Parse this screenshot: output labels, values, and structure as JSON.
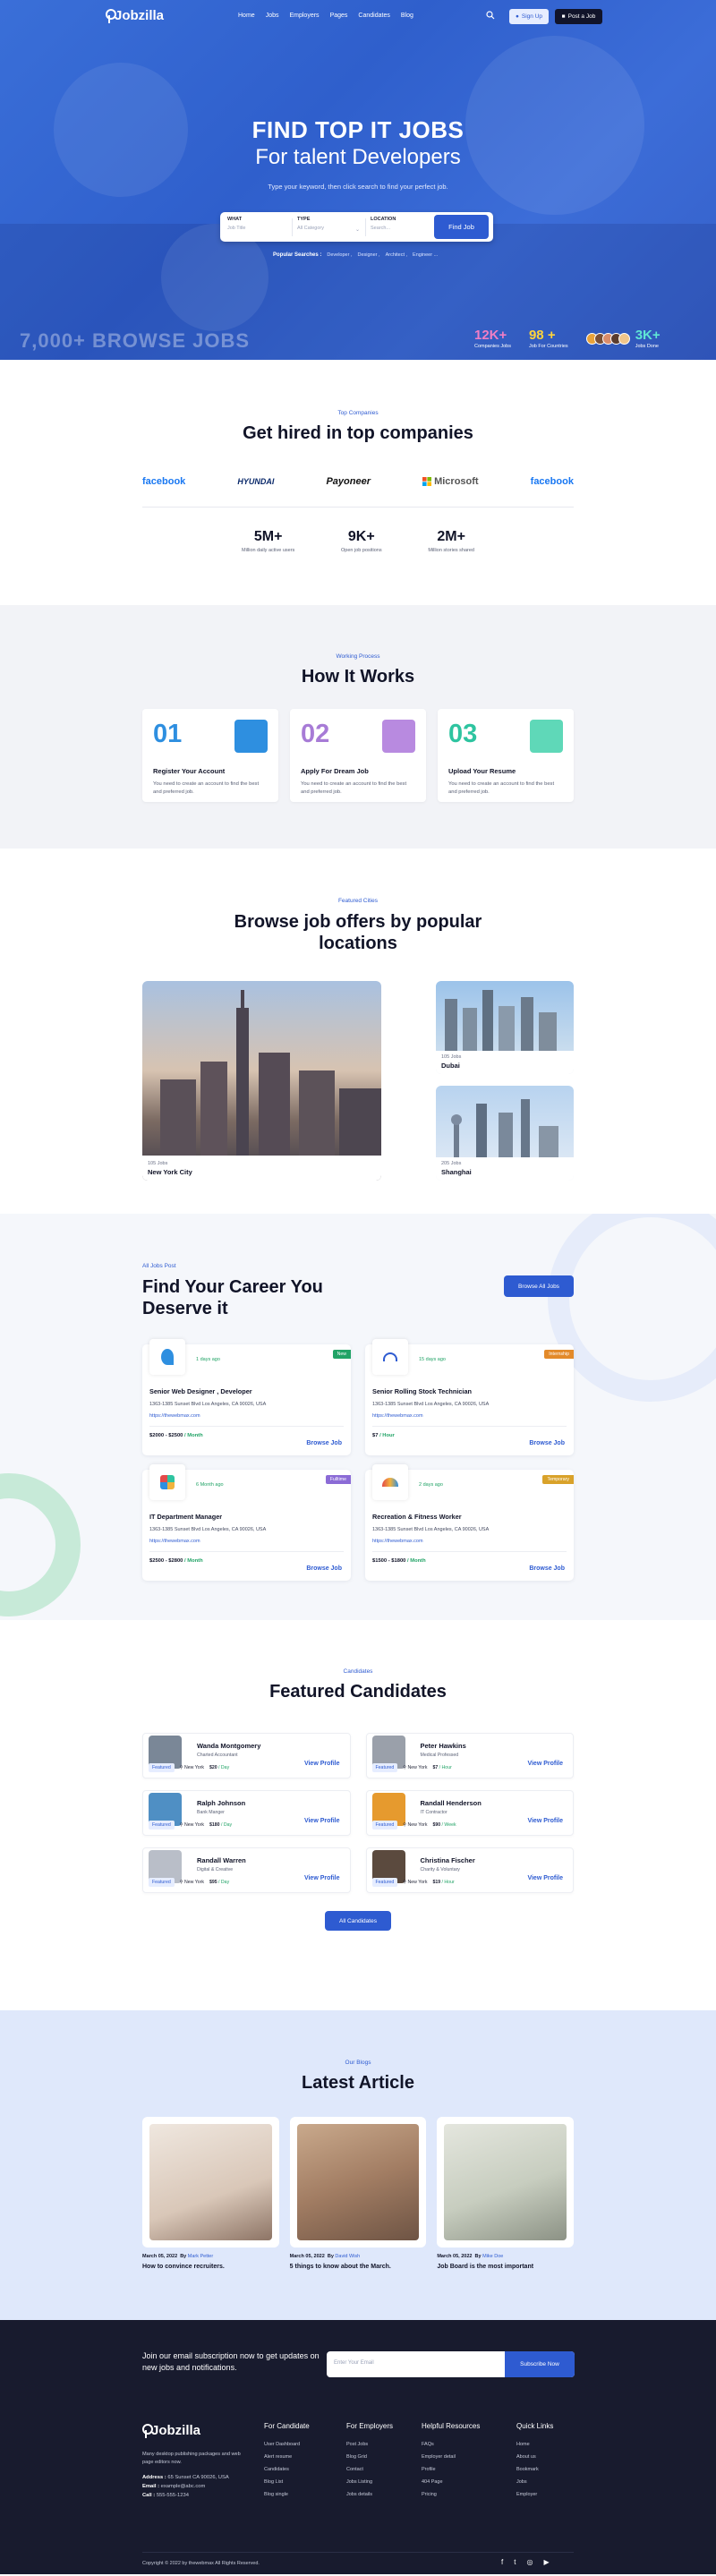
{
  "brand": {
    "name": "Jobzilla"
  },
  "nav": {
    "items": [
      "Home",
      "Jobs",
      "Employers",
      "Pages",
      "Candidates",
      "Blog"
    ],
    "sign_up": "Sign Up",
    "post_job": "Post a Job"
  },
  "hero": {
    "title": "FIND TOP IT JOBS",
    "subtitle": "For talent Developers",
    "description": "Type your keyword, then click search to find your perfect job.",
    "search": {
      "what_label": "WHAT",
      "what_placeholder": "Job Title",
      "type_label": "TYPE",
      "type_value": "All Category",
      "location_label": "LOCATION",
      "location_placeholder": "Search...",
      "button": "Find Job"
    },
    "popular_label": "Popular Searches :",
    "popular": [
      "Developer ,",
      "Designer ,",
      "Architect ,",
      "Engineer ..."
    ],
    "browse_text": "7,000+ BROWSE JOBS",
    "stats": [
      {
        "value": "12K+",
        "label": "Companies Jobs",
        "color": "#f07ec5"
      },
      {
        "value": "98 +",
        "label": "Job For Countries",
        "color": "#ffd43b"
      },
      {
        "value": "3K+",
        "label": "Jobs Done",
        "color": "#5fe5d5"
      }
    ]
  },
  "companies": {
    "tag": "Top Companies",
    "title": "Get hired in top companies",
    "logos": [
      "facebook",
      "HYUNDAI",
      "Payoneer",
      "Microsoft",
      "facebook"
    ],
    "numbers": [
      {
        "value": "5M+",
        "label": "Million daily active users"
      },
      {
        "value": "9K+",
        "label": "Open job positions"
      },
      {
        "value": "2M+",
        "label": "Million stories shared"
      }
    ]
  },
  "how": {
    "tag": "Working Process",
    "title": "How It Works",
    "steps": [
      {
        "num": "01",
        "title": "Register Your Account",
        "desc": "You need to create an account to find the best and preferred job.",
        "color": "#2e8fe0",
        "icon_bg": "#2e8fe0"
      },
      {
        "num": "02",
        "title": "Apply For Dream Job",
        "desc": "You need to create an account to find the best and preferred job.",
        "color": "#a77bd6",
        "icon_bg": "#b88ae0"
      },
      {
        "num": "03",
        "title": "Upload Your Resume",
        "desc": "You need to create an account to find the best and preferred job.",
        "color": "#2ec4a0",
        "icon_bg": "#5fd8b8"
      }
    ]
  },
  "cities": {
    "tag": "Featured Cities",
    "title": "Browse job offers by popular locations",
    "items": [
      {
        "jobs": "105 Jobs",
        "name": "New York City"
      },
      {
        "jobs": "105 Jobs",
        "name": "Dubai"
      },
      {
        "jobs": "205 Jobs",
        "name": "Shanghai"
      }
    ]
  },
  "jobs": {
    "tag": "All Jobs Post",
    "title": "Find Your Career You Deserve it",
    "browse_button": "Browse All Jobs",
    "items": [
      {
        "ago": "1 days ago",
        "badge": "New",
        "badge_color": "#21a366",
        "title": "Senior Web Designer , Developer",
        "address": "1363-1385 Sunset Blvd Los Angeles, CA 90026, USA",
        "url": "https://thewebmax.com",
        "salary": "$2000 - $2500",
        "period": " / Month",
        "browse": "Browse Job",
        "logo_color": "#2e8fe0"
      },
      {
        "ago": "15 days ago",
        "badge": "Internship",
        "badge_color": "#e38a2a",
        "title": "Senior Rolling Stock Technician",
        "address": "1363-1385 Sunset Blvd Los Angeles, CA 90026, USA",
        "url": "https://thewebmax.com",
        "salary": "$7",
        "period": " / Hour",
        "browse": "Browse Job",
        "logo_color": "#2e5bd1"
      },
      {
        "ago": "6 Month ago",
        "badge": "Fulltime",
        "badge_color": "#8b6bd6",
        "title": "IT Department Manager",
        "address": "1363-1385 Sunset Blvd Los Angeles, CA 90026, USA",
        "url": "https://thewebmax.com",
        "salary": "$2500 - $2800",
        "period": " / Month",
        "browse": "Browse Job",
        "logo_color": "#2ec4a0"
      },
      {
        "ago": "2 days ago",
        "badge": "Temporary",
        "badge_color": "#d9a22a",
        "title": "Recreation & Fitness Worker",
        "address": "1363-1385 Sunset Blvd Los Angeles, CA 90026, USA",
        "url": "https://thewebmax.com",
        "salary": "$1500 - $1800",
        "period": " / Month",
        "browse": "Browse Job",
        "logo_color": "#e34a4a"
      }
    ]
  },
  "candidates": {
    "tag": "Candidates",
    "title": "Featured Candidates",
    "featured_label": "Featured",
    "view_label": "View Profile",
    "all_button": "All Candidates",
    "items": [
      {
        "name": "Wanda Montgomery",
        "role": "Charted Accountant",
        "location": "New York",
        "rate": "$20",
        "period": " / Day",
        "photo": "#7a8797"
      },
      {
        "name": "Peter Hawkins",
        "role": "Medical Professed",
        "location": "New York",
        "rate": "$7",
        "period": " / Hour",
        "photo": "#9aa0aa"
      },
      {
        "name": "Ralph Johnson",
        "role": "Bank Manger",
        "location": "New York",
        "rate": "$180",
        "period": " / Day",
        "photo": "#4f8fc4"
      },
      {
        "name": "Randall Henderson",
        "role": "IT Contractor",
        "location": "New York",
        "rate": "$90",
        "period": " / Week",
        "photo": "#e69a2e"
      },
      {
        "name": "Randall Warren",
        "role": "Digital & Creative",
        "location": "New York",
        "rate": "$95",
        "period": " / Day",
        "photo": "#b9bec8"
      },
      {
        "name": "Christina Fischer",
        "role": "Charity & Voluntary",
        "location": "New York",
        "rate": "$19",
        "period": " / Hour",
        "photo": "#5b4a3e"
      }
    ]
  },
  "blog": {
    "tag": "Our Blogs",
    "title": "Latest Article",
    "items": [
      {
        "date": "March 05, 2022",
        "by": "By",
        "author": "Mark Petter",
        "title": "How to convince recruiters.",
        "img": "#d9c7b8"
      },
      {
        "date": "March 05, 2022",
        "by": "By",
        "author": "David Wish",
        "title": "5 things to know about the March.",
        "img": "#a27d63"
      },
      {
        "date": "March 05, 2022",
        "by": "By",
        "author": "Mike Doe",
        "title": "Job Board is the most important",
        "img": "#c7cdbf"
      }
    ]
  },
  "footer": {
    "newsletter": "Join our email subscription now to get updates on new jobs and notifications.",
    "email_placeholder": "Enter Your Email",
    "subscribe": "Subscribe Now",
    "desc": "Many desktop publishing packages and web page editors now.",
    "address_label": "Address :",
    "address": "65 Sunset CA 90026, USA",
    "email_label": "Email :",
    "email": "example@abc.com",
    "call_label": "Call :",
    "call": "555-555-1234",
    "columns": [
      {
        "title": "For Candidate",
        "links": [
          "User Dashboard",
          "Alert resume",
          "Candidates",
          "Blog List",
          "Blog single"
        ]
      },
      {
        "title": "For Employers",
        "links": [
          "Post Jobs",
          "Blog Grid",
          "Contact",
          "Jobs Listing",
          "Jobs details"
        ]
      },
      {
        "title": "Helpful Resources",
        "links": [
          "FAQs",
          "Employer detail",
          "Profile",
          "404 Page",
          "Pricing"
        ]
      },
      {
        "title": "Quick Links",
        "links": [
          "Home",
          "About us",
          "Bookmark",
          "Jobs",
          "Employer"
        ]
      }
    ],
    "copyright": "Copyright © 2022 by thewebmax All Rights Reserved.",
    "social": [
      "f",
      "t",
      "◎",
      "▶"
    ]
  },
  "colors": {
    "primary": "#2e5bd1",
    "dark": "#181b2e",
    "green": "#21a366"
  }
}
